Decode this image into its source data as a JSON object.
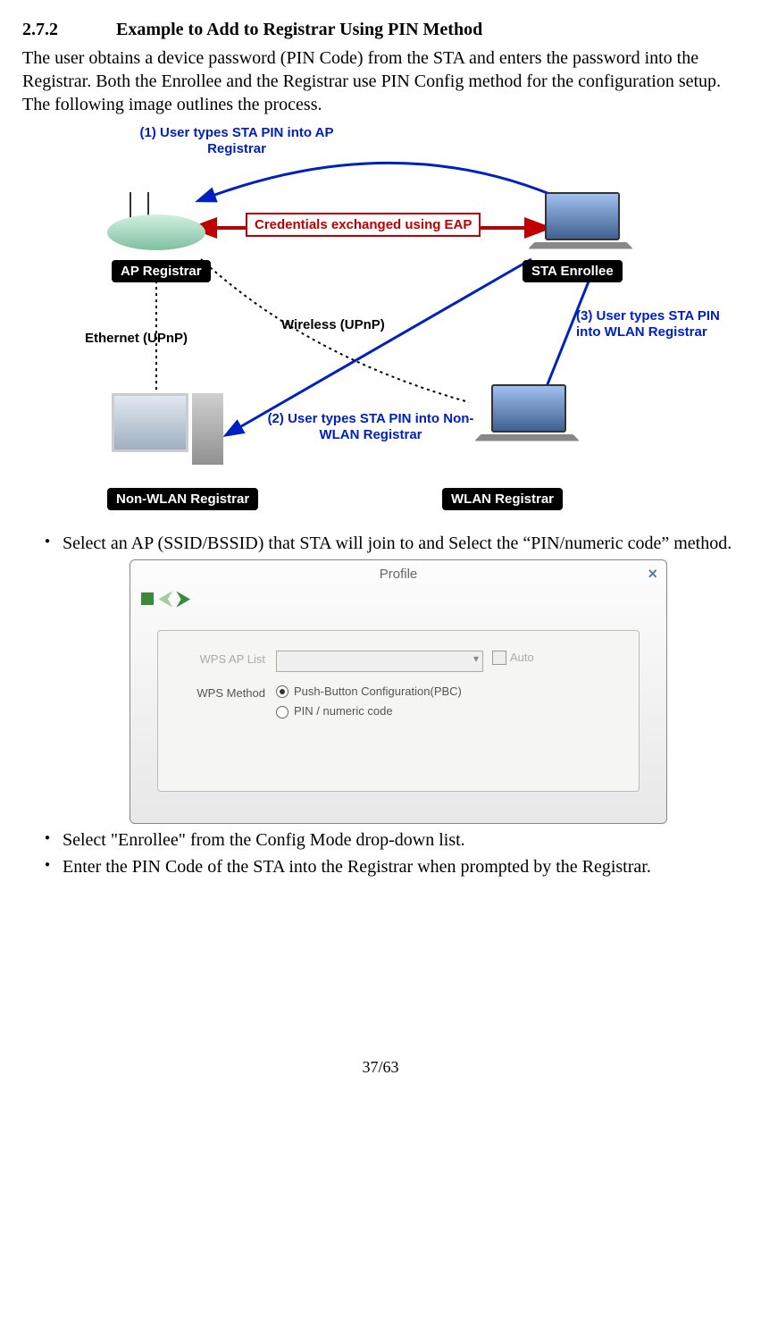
{
  "section": {
    "number": "2.7.2",
    "title": "Example to Add to Registrar Using PIN Method"
  },
  "intro": "The user obtains a device password (PIN Code) from the STA and enters the password into the Registrar. Both the Enrollee and the Registrar use PIN Config method for the configuration setup. The following image outlines the process.",
  "diagram": {
    "step1": "(1) User types STA PIN into AP Registrar",
    "credbox": "Credentials exchanged using EAP",
    "ap_reg": "AP Registrar",
    "sta_enr": "STA Enrollee",
    "eth": "Ethernet (UPnP)",
    "wlan_upnp": "Wireless (UPnP)",
    "step2": "(2) User types STA PIN into Non-WLAN Registrar",
    "step3": "(3) User types STA PIN into WLAN Registrar",
    "non_wlan": "Non-WLAN Registrar",
    "wlan_reg": "WLAN Registrar"
  },
  "bullets": {
    "b1": "Select an AP (SSID/BSSID) that STA will join to and Select the “PIN/numeric code” method.",
    "b2": "Select \"Enrollee\" from the Config Mode drop-down list.",
    "b3": "Enter the PIN Code of the STA into the Registrar when prompted by the Registrar."
  },
  "profile": {
    "title": "Profile",
    "ap_list_label": "WPS AP List",
    "auto_label": "Auto",
    "method_label": "WPS Method",
    "opt_pbc": "Push-Button Configuration(PBC)",
    "opt_pin": "PIN / numeric code"
  },
  "page": "37/63"
}
